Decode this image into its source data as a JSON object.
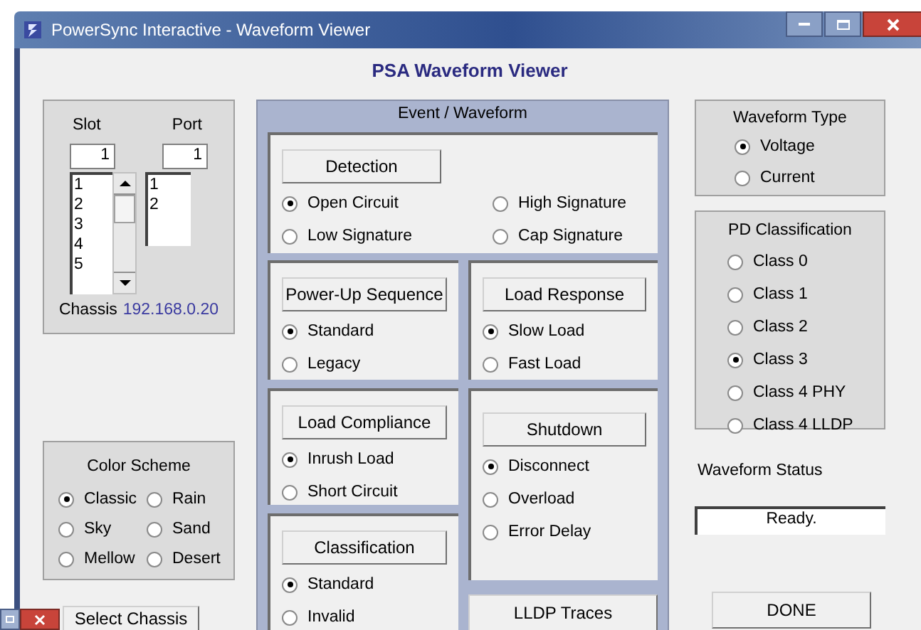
{
  "window": {
    "title": "PowerSync Interactive - Waveform Viewer"
  },
  "header": "PSA Waveform Viewer",
  "slot_port": {
    "slot_label": "Slot",
    "port_label": "Port",
    "slot_value": "1",
    "port_value": "1",
    "slot_items": [
      "1",
      "2",
      "3",
      "4",
      "5"
    ],
    "port_items": [
      "1",
      "2"
    ],
    "chassis_label": "Chassis",
    "chassis_ip": "192.168.0.20"
  },
  "color_scheme": {
    "title": "Color Scheme",
    "options": [
      {
        "label": "Classic",
        "selected": true
      },
      {
        "label": "Rain",
        "selected": false
      },
      {
        "label": "Sky",
        "selected": false
      },
      {
        "label": "Sand",
        "selected": false
      },
      {
        "label": "Mellow",
        "selected": false
      },
      {
        "label": "Desert",
        "selected": false
      }
    ]
  },
  "select_chassis_button": "Select Chassis",
  "event_panel": {
    "title": "Event / Waveform",
    "detection": {
      "button": "Detection",
      "options": [
        {
          "label": "Open Circuit",
          "selected": true
        },
        {
          "label": "Low Signature",
          "selected": false
        },
        {
          "label": "High Signature",
          "selected": false
        },
        {
          "label": "Cap Signature",
          "selected": false
        }
      ]
    },
    "left_groups": [
      {
        "button": "Power-Up Sequence",
        "options": [
          {
            "label": "Standard",
            "selected": true
          },
          {
            "label": "Legacy",
            "selected": false
          }
        ]
      },
      {
        "button": "Load Compliance",
        "options": [
          {
            "label": "Inrush Load",
            "selected": true
          },
          {
            "label": "Short Circuit",
            "selected": false
          }
        ]
      },
      {
        "button": "Classification",
        "options": [
          {
            "label": "Standard",
            "selected": true
          },
          {
            "label": "Invalid",
            "selected": false
          }
        ]
      }
    ],
    "right_groups": [
      {
        "button": "Load Response",
        "options": [
          {
            "label": "Slow Load",
            "selected": true
          },
          {
            "label": "Fast Load",
            "selected": false
          }
        ]
      },
      {
        "button": "Shutdown",
        "options": [
          {
            "label": "Disconnect",
            "selected": true
          },
          {
            "label": "Overload",
            "selected": false
          },
          {
            "label": "Error Delay",
            "selected": false
          }
        ]
      }
    ],
    "lldp_button": "LLDP Traces"
  },
  "waveform_type": {
    "title": "Waveform Type",
    "options": [
      {
        "label": "Voltage",
        "selected": true
      },
      {
        "label": "Current",
        "selected": false
      }
    ]
  },
  "pd_classification": {
    "title": "PD Classification",
    "options": [
      {
        "label": "Class 0",
        "selected": false
      },
      {
        "label": "Class 1",
        "selected": false
      },
      {
        "label": "Class 2",
        "selected": false
      },
      {
        "label": "Class 3",
        "selected": true
      },
      {
        "label": "Class 4 PHY",
        "selected": false
      },
      {
        "label": "Class 4 LLDP",
        "selected": false
      }
    ]
  },
  "waveform_status": {
    "label": "Waveform Status",
    "value": "Ready."
  },
  "done_button": "DONE"
}
